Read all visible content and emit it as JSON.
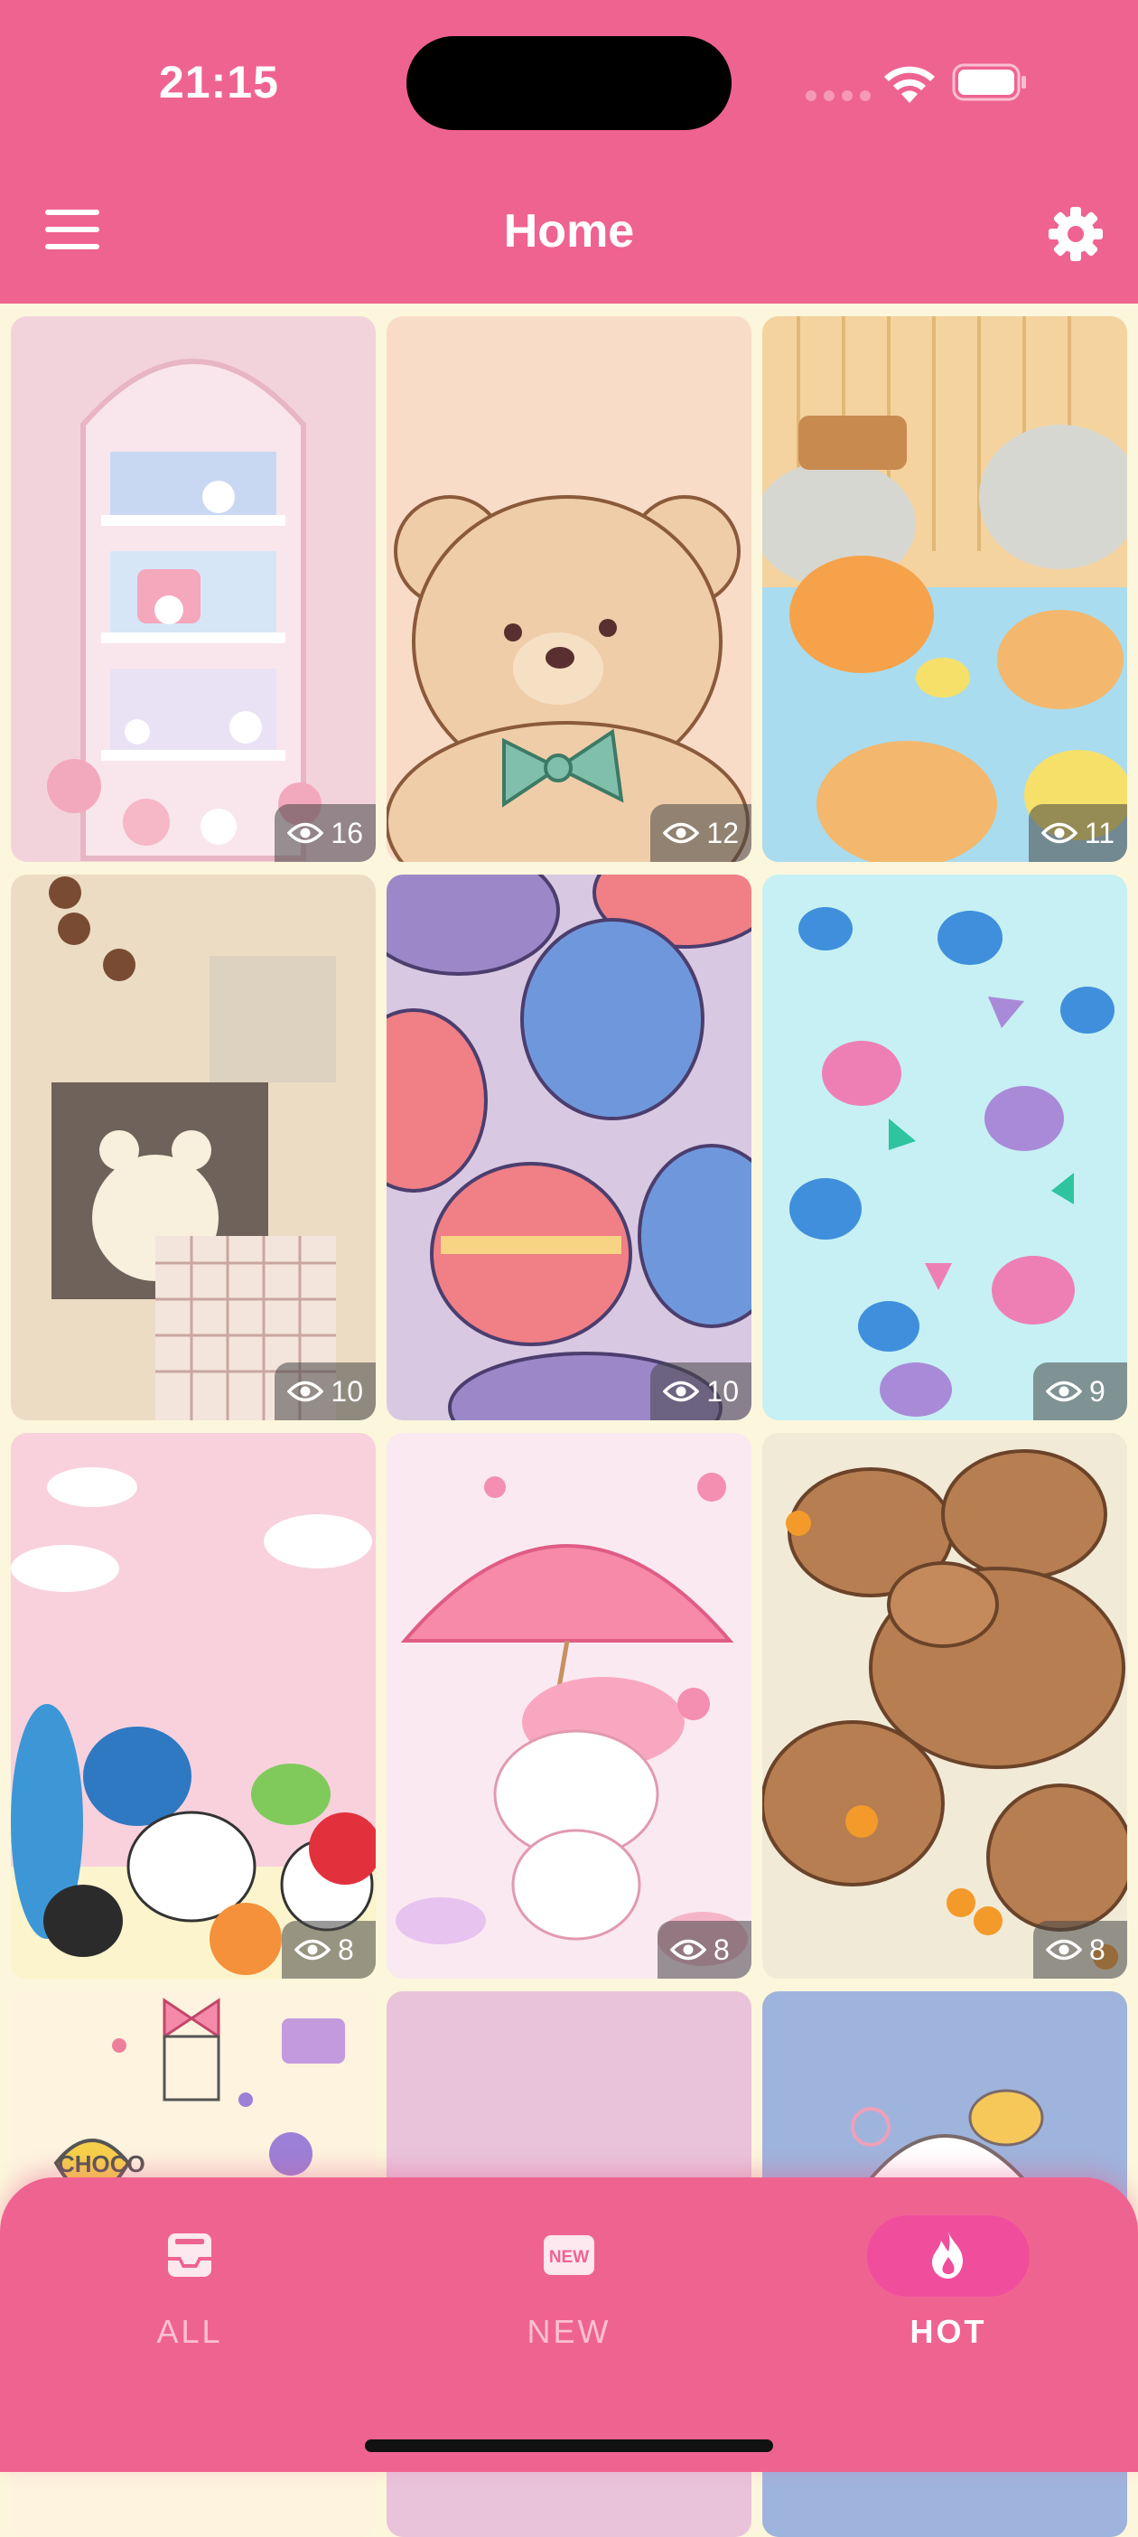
{
  "status_bar": {
    "time": "21:15"
  },
  "header": {
    "title": "Home"
  },
  "wallpapers": [
    {
      "views": "16",
      "subject": "pastel shelf with bunnies and cakes"
    },
    {
      "views": "12",
      "subject": "teddy bear with green bow"
    },
    {
      "views": "11",
      "subject": "capybaras with oranges in hot spring"
    },
    {
      "views": "10",
      "subject": "beige bear collage"
    },
    {
      "views": "10",
      "subject": "macarons pattern"
    },
    {
      "views": "9",
      "subject": "penguins pattern"
    },
    {
      "views": "8",
      "subject": "character group on pink sky"
    },
    {
      "views": "8",
      "subject": "bunny under strawberry umbrella"
    },
    {
      "views": "8",
      "subject": "capybara family"
    },
    {
      "subject": "cream doodle pattern",
      "text": "CHOCO"
    },
    {
      "subject": "plain lilac"
    },
    {
      "subject": "blue with character"
    }
  ],
  "bottom_nav": {
    "items": [
      {
        "label": "ALL",
        "icon": "inbox-icon",
        "active": false
      },
      {
        "label": "NEW",
        "icon": "new-badge-icon",
        "badge_text": "NEW",
        "active": false
      },
      {
        "label": "HOT",
        "icon": "flame-icon",
        "active": true
      }
    ]
  },
  "colors": {
    "header": "#ef6391",
    "background": "#fcf6dc",
    "active_pill": "#f04d9d"
  }
}
